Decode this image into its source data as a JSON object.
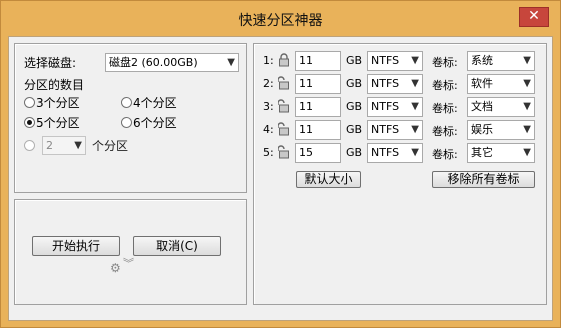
{
  "window": {
    "title": "快速分区神器",
    "close_label": "✕"
  },
  "left": {
    "select_disk_label": "选择磁盘:",
    "disk_value": "磁盘2 (60.00GB)",
    "partition_count_label": "分区的数目",
    "options": [
      "3个分区",
      "4个分区",
      "5个分区",
      "6个分区"
    ],
    "selected_option": "5个分区",
    "custom_value": "2",
    "custom_suffix": "个分区",
    "start_button": "开始执行",
    "cancel_button": "取消(C)"
  },
  "right": {
    "unit": "GB",
    "volume_label_caption": "卷标:",
    "rows": [
      {
        "index": "1:",
        "size": "11",
        "fs": "NTFS",
        "label": "系统",
        "locked": true
      },
      {
        "index": "2:",
        "size": "11",
        "fs": "NTFS",
        "label": "软件",
        "locked": false
      },
      {
        "index": "3:",
        "size": "11",
        "fs": "NTFS",
        "label": "文档",
        "locked": false
      },
      {
        "index": "4:",
        "size": "11",
        "fs": "NTFS",
        "label": "娱乐",
        "locked": false
      },
      {
        "index": "5:",
        "size": "15",
        "fs": "NTFS",
        "label": "其它",
        "locked": false
      }
    ],
    "default_size_button": "默认大小",
    "remove_labels_button": "移除所有卷标"
  }
}
